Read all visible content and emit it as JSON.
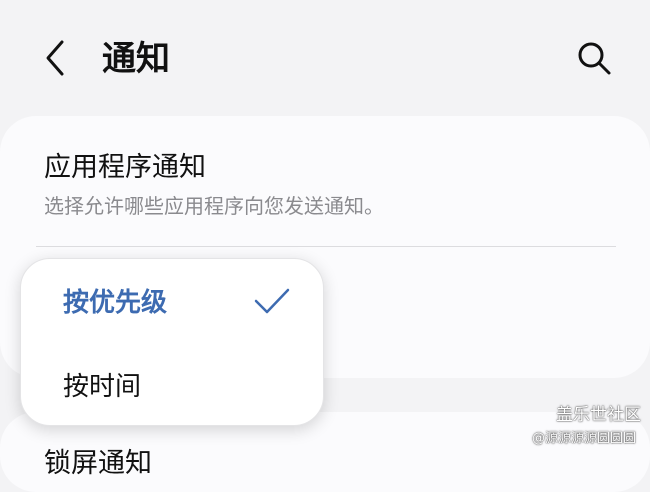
{
  "header": {
    "title": "通知",
    "back_icon": "chevron-left-icon",
    "search_icon": "search-icon"
  },
  "app_notifications": {
    "title": "应用程序通知",
    "subtitle": "选择允许哪些应用程序向您发送通知。"
  },
  "sort_menu": {
    "options": [
      {
        "label": "按优先级",
        "selected": true
      },
      {
        "label": "按时间",
        "selected": false
      }
    ],
    "accent_color": "#3d6bb1"
  },
  "next_section": {
    "title": "锁屏通知"
  },
  "watermark": {
    "line1": "盖乐世社区",
    "line2": "@源源源源圆圆圆"
  }
}
